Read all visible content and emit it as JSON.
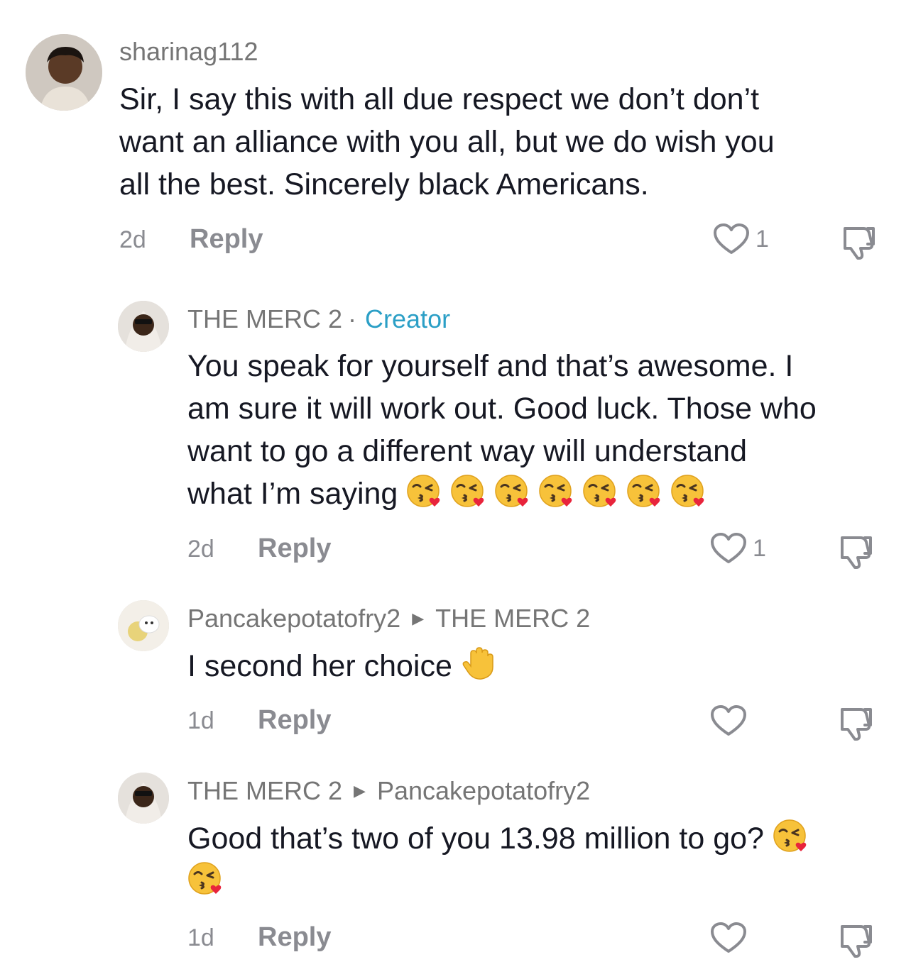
{
  "comments": [
    {
      "username": "sharinag112",
      "text": "Sir, I say this with all due respect we don’t don’t\nwant an alliance with you all, but we do wish you\nall the best. Sincerely black Americans.",
      "time": "2d",
      "reply_label": "Reply",
      "likes": "1"
    },
    {
      "username": "THE MERC 2",
      "separator": "·",
      "badge": "Creator",
      "text": "You speak for yourself and that’s awesome. I\nam sure it will work out. Good luck. Those who\nwant to go a different way will understand\nwhat I’m saying ",
      "emoji": [
        "😘",
        "😘",
        "😘",
        "😘",
        "😘",
        "😘",
        "😘"
      ],
      "time": "2d",
      "reply_label": "Reply",
      "likes": "1"
    },
    {
      "username": "Pancakepotatofry2",
      "reply_to": "THE MERC 2",
      "text": "I second her choice ",
      "emoji": [
        "✋"
      ],
      "time": "1d",
      "reply_label": "Reply",
      "likes": ""
    },
    {
      "username": "THE MERC 2",
      "reply_to": "Pancakepotatofry2",
      "text": "Good that’s two of you 13.98 million to go? ",
      "emoji": [
        "😘",
        "😘"
      ],
      "time": "1d",
      "reply_label": "Reply",
      "likes": ""
    }
  ],
  "icons": {
    "like": "heart-outline-icon",
    "dislike": "thumbs-down-icon",
    "reply_arrow": "triangle-right-icon",
    "kiss_emoji": "face-blowing-kiss-emoji",
    "hand_emoji": "raised-hand-emoji"
  },
  "colors": {
    "text": "#161823",
    "secondary": "#757575",
    "creator_badge": "#2b9fc6"
  }
}
